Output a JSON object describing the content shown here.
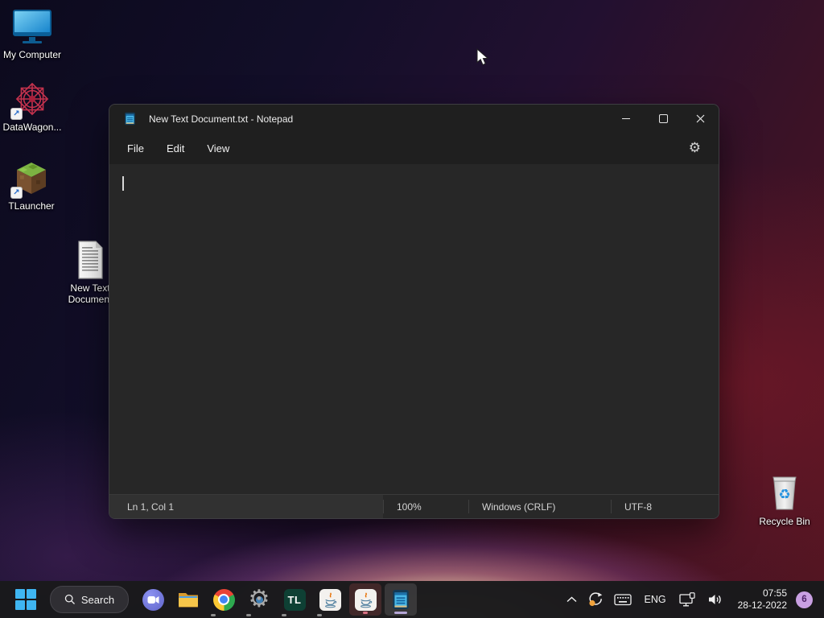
{
  "desktop": {
    "icons": [
      {
        "label": "My Computer",
        "icon": "computer-monitor"
      },
      {
        "label": "DataWagon...",
        "icon": "datawagon-star",
        "shortcut": true
      },
      {
        "label": "TLauncher",
        "icon": "minecraft-grass-block",
        "shortcut": true
      },
      {
        "label": "New Text Document",
        "icon": "text-document"
      },
      {
        "label": "Recycle Bin",
        "icon": "recycle-bin"
      }
    ],
    "shortcut_arrow": "↗"
  },
  "window": {
    "title": "New Text Document.txt - Notepad",
    "app_icon": "notepad-icon",
    "menu": {
      "file": "File",
      "edit": "Edit",
      "view": "View"
    },
    "controls": [
      "minimize-icon",
      "maximize-icon",
      "close-icon"
    ],
    "settings_gear": "⚙",
    "statusbar": {
      "cursor_position": "Ln 1, Col 1",
      "zoom_level": "100%",
      "line_endings": "Windows (CRLF)",
      "encoding": "UTF-8"
    }
  },
  "taskbar": {
    "search": {
      "label": "Search",
      "icon": "search-icon"
    },
    "apps": [
      "start",
      "search",
      "chat",
      "file-explorer",
      "chrome",
      "settings",
      "tlauncher",
      "java",
      "java",
      "notepad"
    ],
    "tl_label": "TL",
    "settings_gear": "⚙",
    "tray": {
      "icons": [
        "chevron-up",
        "sync-update",
        "keyboard",
        "language",
        "network-display",
        "speaker"
      ],
      "language": "ENG",
      "time": "07:55",
      "date": "28-12-2022",
      "notification_count": "6"
    }
  },
  "colors": {
    "accent_blue": "#3fb6f2",
    "wallpaper_dark": "#0c0a1d",
    "wallpaper_red": "#521521",
    "glow": "#f9f4c6",
    "window_bg": "#272727",
    "titlebar_bg": "#1f1f1f",
    "taskbar_bg": "#1a191c",
    "badge_purple": "#c9a0e2",
    "notepad_icon_blue": "#49b8e8",
    "indicator_gray": "#8d8d8d",
    "indicator_pink": "#d97285",
    "indicator_lavender": "#b5a6d6"
  }
}
